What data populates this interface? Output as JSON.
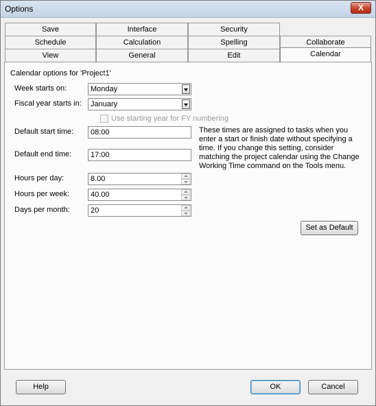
{
  "window": {
    "title": "Options",
    "close_label": "X"
  },
  "tabs": {
    "row1": [
      "Save",
      "Interface",
      "Security"
    ],
    "row2": [
      "Schedule",
      "Calculation",
      "Spelling",
      "Collaborate"
    ],
    "row3": [
      "View",
      "General",
      "Edit",
      "Calendar"
    ],
    "selected": "Calendar"
  },
  "calendar": {
    "section_label": "Calendar options for 'Project1'",
    "week_starts_label": "Week starts on:",
    "week_starts_value": "Monday",
    "fiscal_label": "Fiscal year starts in:",
    "fiscal_value": "January",
    "fy_checkbox_label": "Use starting year for FY numbering",
    "fy_checkbox_checked": false,
    "start_time_label": "Default start time:",
    "start_time_value": "08:00",
    "end_time_label": "Default end time:",
    "end_time_value": "17:00",
    "info_text": "These times are assigned to tasks when you enter a start or finish date without specifying a time. If you change this setting, consider matching the project calendar using the Change Working Time command on the Tools menu.",
    "hours_day_label": "Hours per day:",
    "hours_day_value": "8.00",
    "hours_week_label": "Hours per week:",
    "hours_week_value": "40.00",
    "days_month_label": "Days per month:",
    "days_month_value": "20",
    "set_default_label": "Set as Default"
  },
  "footer": {
    "help_label": "Help",
    "ok_label": "OK",
    "cancel_label": "Cancel"
  }
}
